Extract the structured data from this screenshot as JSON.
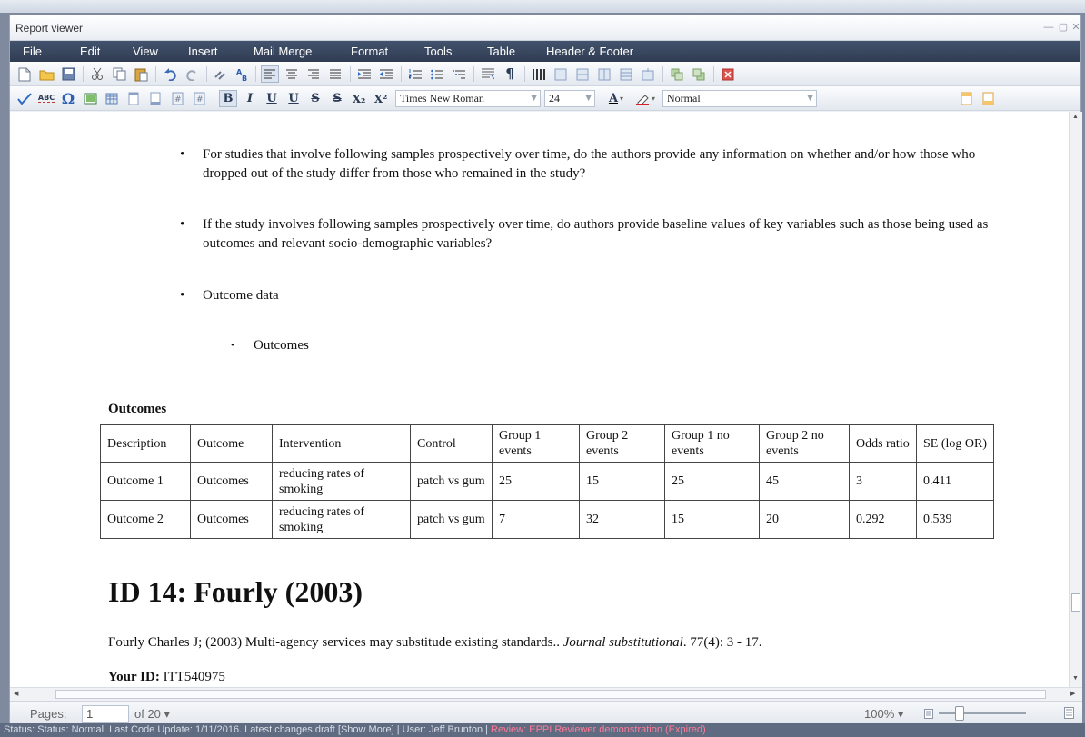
{
  "window": {
    "title": "Report viewer",
    "minimize": "—",
    "restore": "▢",
    "close": "✕"
  },
  "menu": [
    "File",
    "Edit",
    "View",
    "Insert",
    "Mail Merge",
    "Format",
    "Tools",
    "Table",
    "Header & Footer"
  ],
  "toolbar2": {
    "bold": "B",
    "italic": "I",
    "underline": "U",
    "double_underline": "U",
    "strike": "S",
    "double_strike": "S",
    "subscript": "X₂",
    "superscript": "X²",
    "font_name": "Times New Roman",
    "font_size": "24",
    "font_color_letter": "A",
    "style": "Normal",
    "spell_label": "ABC",
    "omega": "Ω"
  },
  "document": {
    "bullets": [
      "For studies that involve following samples prospectively over time, do the authors provide any information on whether and/or how those who dropped out of the study differ from those who remained in the study?",
      "If the study involves following samples prospectively over time, do authors provide baseline values of key variables such as those being used as outcomes and relevant socio-demographic variables?",
      "Outcome data"
    ],
    "sub_bullet": "Outcomes",
    "bullet_char": "•",
    "outcomes_heading": "Outcomes",
    "table": {
      "headers": [
        "Description",
        "Outcome",
        "Intervention",
        "Control",
        "Group 1 events",
        "Group 2 events",
        "Group 1 no events",
        "Group 2 no events",
        "Odds ratio",
        "SE (log OR)"
      ],
      "rows": [
        [
          "Outcome 1",
          "Outcomes",
          "reducing rates of smoking",
          "patch vs gum",
          "25",
          "15",
          "25",
          "45",
          "3",
          "0.411"
        ],
        [
          "Outcome 2",
          "Outcomes",
          "reducing rates of smoking",
          "patch vs gum",
          "7",
          "32",
          "15",
          "20",
          "0.292",
          "0.539"
        ]
      ]
    },
    "study_heading": "ID 14: Fourly (2003)",
    "citation_main": "Fourly Charles J; (2003) Multi-agency services may substitude existing standards.. ",
    "citation_journal": "Journal substitutional",
    "citation_rest": ". 77(4): 3 - 17.",
    "your_id_label": "Your ID:",
    "your_id_value": " ITT540975"
  },
  "bottom": {
    "pages_label": "Pages:",
    "page_value": "1",
    "of_pages": "of 20 ▾",
    "zoom": "100% ▾"
  },
  "statusbar": {
    "text": "Status: Status: Normal. Last Code Update: 1/11/2016. Latest changes draft [Show More] | User: Jeff Brunton | ",
    "review": "Review: EPPI Reviewer demonstration (Expired)"
  }
}
